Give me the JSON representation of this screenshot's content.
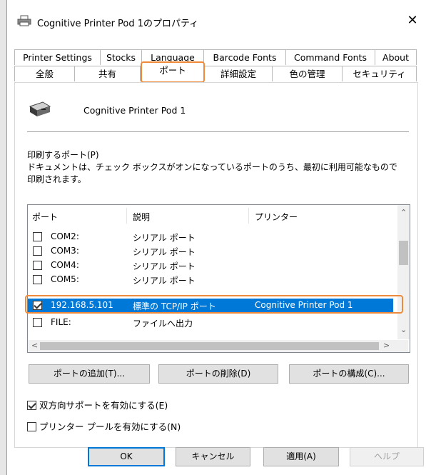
{
  "window": {
    "title": "Cognitive Printer Pod 1のプロパティ",
    "close_label": "✕"
  },
  "tabs_row1": [
    {
      "label": "Printer Settings"
    },
    {
      "label": "Stocks"
    },
    {
      "label": "Language"
    },
    {
      "label": "Barcode Fonts"
    },
    {
      "label": "Command Fonts"
    },
    {
      "label": "About"
    }
  ],
  "tabs_row2": [
    {
      "label": "全般"
    },
    {
      "label": "共有"
    },
    {
      "label": "ポート",
      "active": true
    },
    {
      "label": "詳細設定"
    },
    {
      "label": "色の管理"
    },
    {
      "label": "セキュリティ"
    }
  ],
  "printer_name": "Cognitive Printer Pod 1",
  "ports_section": {
    "label": "印刷するポート(P)",
    "description": "ドキュメントは、チェック ボックスがオンになっているポートのうち、最初に利用可能なもので印刷されます。"
  },
  "port_list": {
    "headers": {
      "port": "ポート",
      "description": "説明",
      "printer": "プリンター"
    },
    "rows": [
      {
        "port": "COM2:",
        "description": "シリアル ポート",
        "printer": "",
        "checked": false
      },
      {
        "port": "COM3:",
        "description": "シリアル ポート",
        "printer": "",
        "checked": false
      },
      {
        "port": "COM4:",
        "description": "シリアル ポート",
        "printer": "",
        "checked": false
      },
      {
        "port": "COM5:",
        "description": "シリアル ポート",
        "printer": "",
        "checked": false
      },
      {
        "port": "192.168.5.101",
        "description": "標準の TCP/IP ポート",
        "printer": "Cognitive Printer Pod 1",
        "checked": true,
        "selected": true
      },
      {
        "port": "FILE:",
        "description": "ファイルへ出力",
        "printer": "",
        "checked": false
      }
    ]
  },
  "port_buttons": {
    "add": "ポートの追加(T)...",
    "delete": "ポートの削除(D)",
    "configure": "ポートの構成(C)..."
  },
  "options": {
    "bidirectional": {
      "label": "双方向サポートを有効にする(E)",
      "checked": true
    },
    "pooling": {
      "label": "プリンター プールを有効にする(N)",
      "checked": false
    }
  },
  "footer": {
    "ok": "OK",
    "cancel": "キャンセル",
    "apply": "適用(A)",
    "help": "ヘルプ"
  },
  "colors": {
    "selection": "#0078d7",
    "highlight_outline": "#ef8a3a"
  }
}
